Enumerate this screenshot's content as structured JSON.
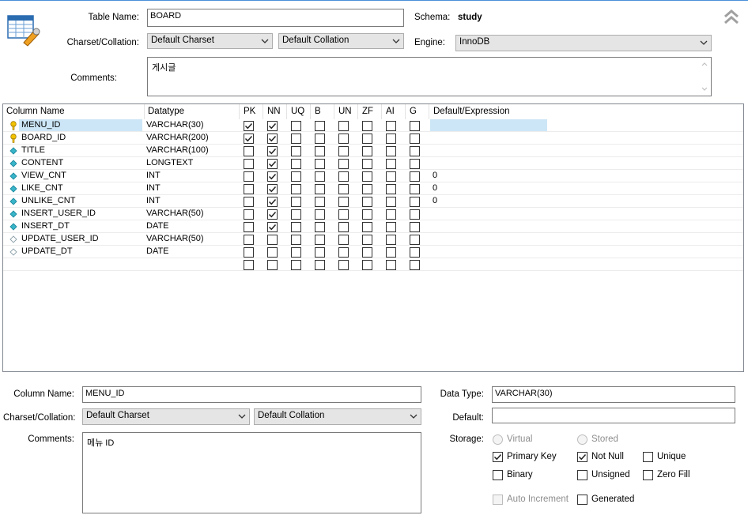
{
  "table": {
    "name_label": "Table Name:",
    "name_value": "BOARD",
    "schema_label": "Schema:",
    "schema_value": "study",
    "charset_label": "Charset/Collation:",
    "charset_value": "Default Charset",
    "collation_value": "Default Collation",
    "engine_label": "Engine:",
    "engine_value": "InnoDB",
    "comments_label": "Comments:",
    "comments_value": "게시글"
  },
  "grid": {
    "headers": [
      "Column Name",
      "Datatype",
      "PK",
      "NN",
      "UQ",
      "B",
      "UN",
      "ZF",
      "AI",
      "G",
      "Default/Expression"
    ],
    "rows": [
      {
        "icon": "key",
        "name": "MENU_ID",
        "type": "VARCHAR(30)",
        "flags": [
          1,
          1,
          0,
          0,
          0,
          0,
          0,
          0
        ],
        "def": "",
        "selected": true
      },
      {
        "icon": "key",
        "name": "BOARD_ID",
        "type": "VARCHAR(200)",
        "flags": [
          1,
          1,
          0,
          0,
          0,
          0,
          0,
          0
        ],
        "def": ""
      },
      {
        "icon": "diamond",
        "name": "TITLE",
        "type": "VARCHAR(100)",
        "flags": [
          0,
          1,
          0,
          0,
          0,
          0,
          0,
          0
        ],
        "def": ""
      },
      {
        "icon": "diamond",
        "name": "CONTENT",
        "type": "LONGTEXT",
        "flags": [
          0,
          1,
          0,
          0,
          0,
          0,
          0,
          0
        ],
        "def": ""
      },
      {
        "icon": "diamond",
        "name": "VIEW_CNT",
        "type": "INT",
        "flags": [
          0,
          1,
          0,
          0,
          0,
          0,
          0,
          0
        ],
        "def": "0"
      },
      {
        "icon": "diamond",
        "name": "LIKE_CNT",
        "type": "INT",
        "flags": [
          0,
          1,
          0,
          0,
          0,
          0,
          0,
          0
        ],
        "def": "0"
      },
      {
        "icon": "diamond",
        "name": "UNLIKE_CNT",
        "type": "INT",
        "flags": [
          0,
          1,
          0,
          0,
          0,
          0,
          0,
          0
        ],
        "def": "0"
      },
      {
        "icon": "diamond",
        "name": "INSERT_USER_ID",
        "type": "VARCHAR(50)",
        "flags": [
          0,
          1,
          0,
          0,
          0,
          0,
          0,
          0
        ],
        "def": ""
      },
      {
        "icon": "diamond",
        "name": "INSERT_DT",
        "type": "DATE",
        "flags": [
          0,
          1,
          0,
          0,
          0,
          0,
          0,
          0
        ],
        "def": ""
      },
      {
        "icon": "diamond-empty",
        "name": "UPDATE_USER_ID",
        "type": "VARCHAR(50)",
        "flags": [
          0,
          0,
          0,
          0,
          0,
          0,
          0,
          0
        ],
        "def": ""
      },
      {
        "icon": "diamond-empty",
        "name": "UPDATE_DT",
        "type": "DATE",
        "flags": [
          0,
          0,
          0,
          0,
          0,
          0,
          0,
          0
        ],
        "def": ""
      },
      {
        "icon": "none",
        "name": "",
        "type": "",
        "flags": [
          0,
          0,
          0,
          0,
          0,
          0,
          0,
          0
        ],
        "def": ""
      }
    ]
  },
  "detail": {
    "colname_label": "Column Name:",
    "colname_value": "MENU_ID",
    "charset_label": "Charset/Collation:",
    "charset_value": "Default Charset",
    "collation_value": "Default Collation",
    "comments_label": "Comments:",
    "comments_value": "메뉴 ID",
    "datatype_label": "Data Type:",
    "datatype_value": "VARCHAR(30)",
    "default_label": "Default:",
    "default_value": "",
    "storage_label": "Storage:",
    "virtual_label": "Virtual",
    "stored_label": "Stored",
    "pk_label": "Primary Key",
    "nn_label": "Not Null",
    "unique_label": "Unique",
    "binary_label": "Binary",
    "unsigned_label": "Unsigned",
    "zerofill_label": "Zero Fill",
    "autoinc_label": "Auto Increment",
    "generated_label": "Generated"
  },
  "colors": {
    "selection": "#cde6f7",
    "accent": "#4a90d9",
    "key_icon": "#f2c200",
    "diamond_icon": "#39b5c9"
  },
  "icons": [
    "table-icon",
    "collapse-icon",
    "key-icon",
    "diamond-icon",
    "chevron-down-icon",
    "checkmark-icon"
  ]
}
